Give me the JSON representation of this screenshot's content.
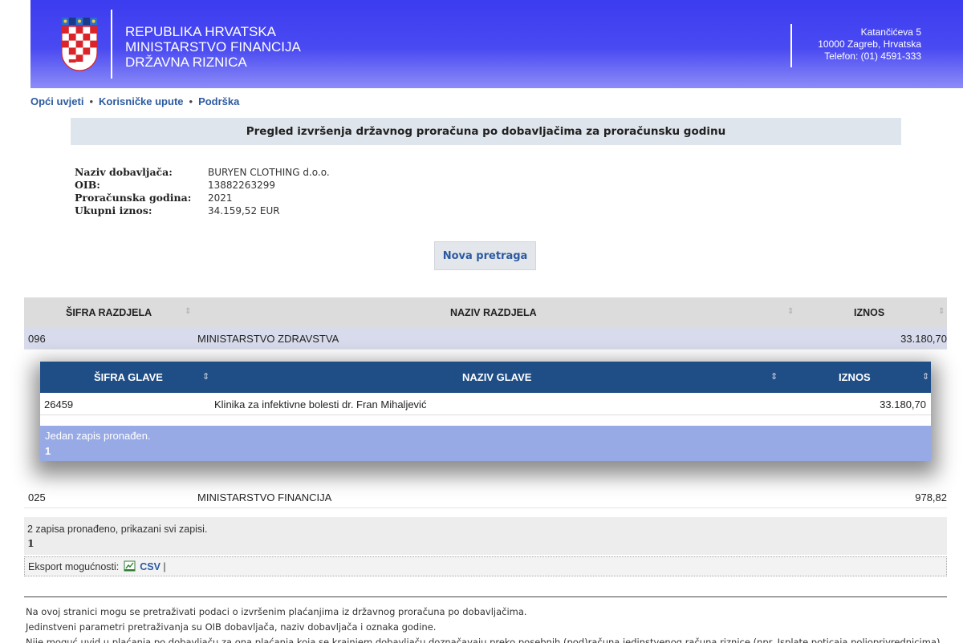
{
  "header": {
    "line1": "REPUBLIKA HRVATSKA",
    "line2": "MINISTARSTVO FINANCIJA",
    "line3": "DRŽAVNA RIZNICA",
    "address1": "Katančićeva 5",
    "address2": "10000 Zagreb, Hrvatska",
    "address3": "Telefon: (01) 4591-333"
  },
  "nav": {
    "link1": "Opći uvjeti",
    "link2": "Korisničke upute",
    "link3": "Podrška",
    "sep": "•"
  },
  "banner": "Pregled izvršenja državnog proračuna po dobavljačima za proračunsku godinu",
  "info": {
    "supplier_label": "Naziv dobavljača:",
    "supplier_value": "BURYEN CLOTHING d.o.o.",
    "oib_label": "OIB:",
    "oib_value": "13882263299",
    "year_label": "Proračunska godina:",
    "year_value": "2021",
    "total_label": "Ukupni iznos:",
    "total_value": "34.159,52 EUR"
  },
  "new_search_label": "Nova pretraga",
  "main_table": {
    "col1": "ŠIFRA RAZDJELA",
    "col2": "NAZIV RAZDJELA",
    "col3": "IZNOS",
    "sort_icon": "⇕",
    "rows": [
      {
        "code": "096",
        "name": "MINISTARSTVO ZDRAVSTVA",
        "amount": "33.180,70"
      },
      {
        "code": "025",
        "name": "MINISTARSTVO FINANCIJA",
        "amount": "978,82"
      }
    ]
  },
  "sub_table": {
    "col1": "ŠIFRA GLAVE",
    "col2": "NAZIV GLAVE",
    "col3": "IZNOS",
    "rows": [
      {
        "code": "26459",
        "name": "Klinika za infektivne bolesti dr. Fran Mihaljević",
        "amount": "33.180,70"
      }
    ],
    "count_text": "Jedan zapis pronađen.",
    "page": "1"
  },
  "main_count_text": "2 zapisa pronađeno, prikazani svi zapisi.",
  "main_page": "1",
  "export": {
    "label": "Eksport mogućnosti:",
    "csv": "CSV",
    "sep": "|"
  },
  "footer": {
    "line1": "Na ovoj stranici mogu se pretraživati podaci o izvršenim plaćanjima iz državnog proračuna po dobavljačima.",
    "line2": "Jedinstveni parametri pretraživanja su OIB dobavljača, naziv dobavljača i oznaka godine.",
    "line3": "Nije moguć uvid u plaćanja po dobavljaču za ona plaćanja koja se krajnjem dobavljaču doznačavaju preko posebnih (pod)računa jedinstvenog računa riznice (npr. Isplate poticaja poljoprivrednicima)."
  },
  "colors": {
    "header_blue": "#3c3cf0",
    "link_blue": "#2c5aa0",
    "sub_header": "#1f4e86",
    "sub_footer": "#98aae6"
  }
}
